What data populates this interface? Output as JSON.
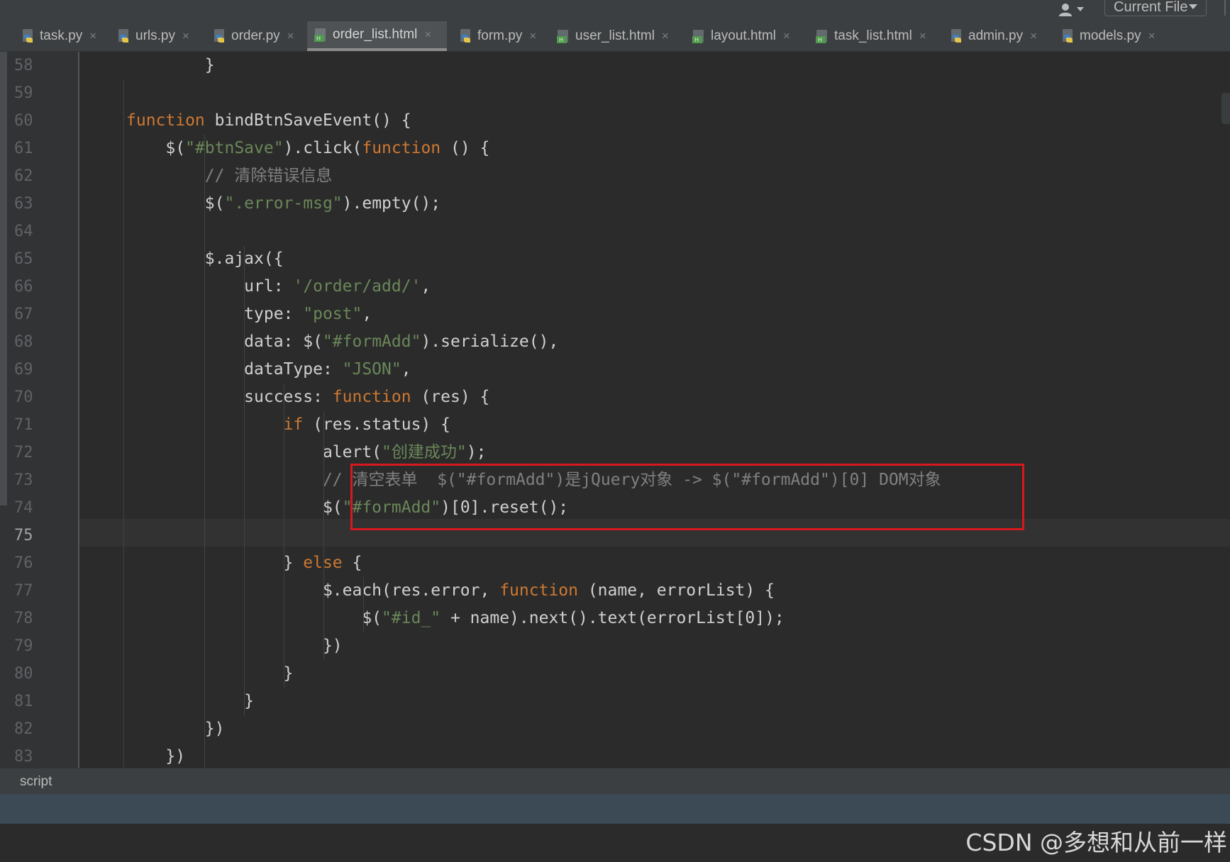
{
  "toolbar": {
    "scope_select": "Current File",
    "user_icon": "user-icon"
  },
  "tabs": [
    {
      "label": "task.py",
      "icon": "python-file-icon",
      "close": "×"
    },
    {
      "label": "urls.py",
      "icon": "python-file-icon",
      "close": "×"
    },
    {
      "label": "order.py",
      "icon": "python-file-icon",
      "close": "×"
    },
    {
      "label": "order_list.html",
      "icon": "html-file-icon",
      "close": "×",
      "active": true
    },
    {
      "label": "form.py",
      "icon": "python-file-icon",
      "close": "×"
    },
    {
      "label": "user_list.html",
      "icon": "html-file-icon",
      "close": "×"
    },
    {
      "label": "layout.html",
      "icon": "html-file-icon",
      "close": "×"
    },
    {
      "label": "task_list.html",
      "icon": "html-file-icon",
      "close": "×"
    },
    {
      "label": "admin.py",
      "icon": "python-file-icon",
      "close": "×"
    },
    {
      "label": "models.py",
      "icon": "python-file-icon",
      "close": "×"
    }
  ],
  "editor": {
    "current_line": 75,
    "lines": [
      {
        "n": "58",
        "text": "        }"
      },
      {
        "n": "59",
        "text": ""
      },
      {
        "n": "60",
        "text": "function bindBtnSaveEvent() {"
      },
      {
        "n": "61",
        "text": "    $(\"#btnSave\").click(function () {"
      },
      {
        "n": "62",
        "text": "        // 清除错误信息"
      },
      {
        "n": "63",
        "text": "        $(\".error-msg\").empty();"
      },
      {
        "n": "64",
        "text": ""
      },
      {
        "n": "65",
        "text": "        $.ajax({"
      },
      {
        "n": "66",
        "text": "            url: '/order/add/',"
      },
      {
        "n": "67",
        "text": "            type: \"post\","
      },
      {
        "n": "68",
        "text": "            data: $(\"#formAdd\").serialize(),"
      },
      {
        "n": "69",
        "text": "            dataType: \"JSON\","
      },
      {
        "n": "70",
        "text": "            success: function (res) {"
      },
      {
        "n": "71",
        "text": "                if (res.status) {"
      },
      {
        "n": "72",
        "text": "                    alert(\"创建成功\");"
      },
      {
        "n": "73",
        "text": "                    // 清空表单  $(\"#formAdd\")是jQuery对象 -> $(\"#formAdd\")[0] DOM对象"
      },
      {
        "n": "74",
        "text": "                    $(\"#formAdd\")[0].reset();"
      },
      {
        "n": "75",
        "text": ""
      },
      {
        "n": "76",
        "text": "                } else {"
      },
      {
        "n": "77",
        "text": "                    $.each(res.error, function (name, errorList) {"
      },
      {
        "n": "78",
        "text": "                        $(\"#id_\" + name).next().text(errorList[0]);"
      },
      {
        "n": "79",
        "text": "                    })"
      },
      {
        "n": "80",
        "text": "                }"
      },
      {
        "n": "81",
        "text": "            }"
      },
      {
        "n": "82",
        "text": "        })"
      },
      {
        "n": "83",
        "text": "    })"
      }
    ]
  },
  "breadcrumb": "script",
  "watermark": "CSDN @多想和从前一样",
  "colors": {
    "editor_bg": "#2b2b2b",
    "tab_bar_bg": "#3c3f41",
    "highlight_box": "#d7191e",
    "keyword": "#cc7832",
    "string": "#6a8759",
    "comment": "#808080"
  }
}
